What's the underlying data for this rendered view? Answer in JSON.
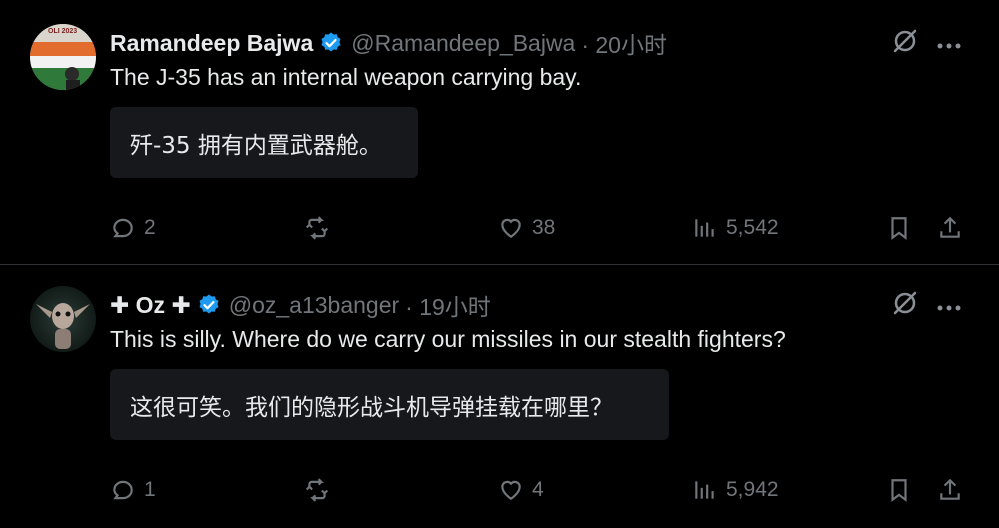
{
  "tweets": [
    {
      "name": "Ramandeep Bajwa",
      "handle": "@Ramandeep_Bajwa",
      "time": "· 20小时",
      "text": "The J-35 has an internal weapon carrying bay.",
      "translation": "歼-35 拥有内置武器舱。",
      "replies": "2",
      "retweets": "",
      "likes": "38",
      "views": "5,542",
      "avatar_text": "OLI 2023"
    },
    {
      "name": "✚ Oz ✚",
      "handle": "@oz_a13banger",
      "time": "· 19小时",
      "text": "This is silly. Where do we carry our missiles in our stealth fighters?",
      "translation": "这很可笑。我们的隐形战斗机导弹挂载在哪里？",
      "replies": "1",
      "retweets": "",
      "likes": "4",
      "views": "5,942"
    }
  ],
  "colors": {
    "background": "#000000",
    "text": "#e7e9ea",
    "muted": "#71767b",
    "verified": "#1d9bf0",
    "divider": "#2f3336",
    "translate_bg": "#16181c"
  },
  "icons": [
    "verified-badge-icon",
    "grok-icon",
    "more-icon",
    "reply-icon",
    "retweet-icon",
    "like-icon",
    "views-icon",
    "bookmark-icon",
    "share-icon"
  ]
}
